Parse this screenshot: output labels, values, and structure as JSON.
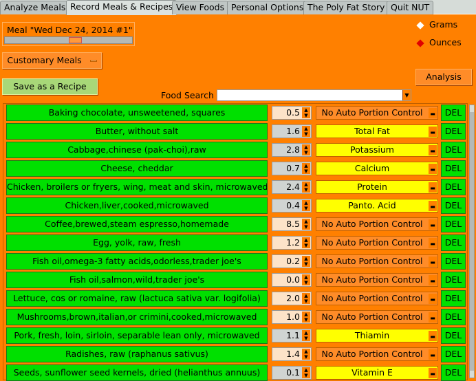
{
  "tabs": [
    "Analyze Meals",
    "Record Meals & Recipes",
    "View Foods",
    "Personal Options",
    "The Poly Fat Story",
    "Quit NUT"
  ],
  "active_tab": 1,
  "meal": {
    "label": "Meal \"Wed Dec 24, 2014 #1\""
  },
  "customary_meals": "Customary Meals",
  "save_recipe": "Save as a Recipe",
  "units": {
    "grams": "Grams",
    "ounces": "Ounces",
    "selected": "Ounces"
  },
  "analysis": "Analysis",
  "food_search": {
    "label": "Food Search",
    "value": ""
  },
  "del_label": "DEL",
  "colors": {
    "background": "#ff8000",
    "food": "#00e000",
    "auto": "#ffff00",
    "spin_manual": "#fde3c8",
    "spin_auto": "#d0d4d2"
  },
  "rows": [
    {
      "food": "Baking chocolate, unsweetened, squares",
      "qty": "0.5",
      "portion": "No Auto Portion Control",
      "auto": false
    },
    {
      "food": "Butter, without salt",
      "qty": "1.6",
      "portion": "Total Fat",
      "auto": true
    },
    {
      "food": "Cabbage,chinese (pak-choi),raw",
      "qty": "2.8",
      "portion": "Potassium",
      "auto": true
    },
    {
      "food": "Cheese, cheddar",
      "qty": "0.7",
      "portion": "Calcium",
      "auto": true
    },
    {
      "food": "Chicken, broilers or fryers, wing, meat and skin, microwaved",
      "qty": "2.4",
      "portion": "Protein",
      "auto": true
    },
    {
      "food": "Chicken,liver,cooked,microwaved",
      "qty": "0.4",
      "portion": "Panto. Acid",
      "auto": true
    },
    {
      "food": "Coffee,brewed,steam espresso,homemade",
      "qty": "8.5",
      "portion": "No Auto Portion Control",
      "auto": false
    },
    {
      "food": "Egg, yolk, raw, fresh",
      "qty": "1.2",
      "portion": "No Auto Portion Control",
      "auto": false
    },
    {
      "food": "Fish oil,omega-3 fatty acids,odorless,trader joe's",
      "qty": "0.2",
      "portion": "No Auto Portion Control",
      "auto": false
    },
    {
      "food": "Fish oil,salmon,wild,trader joe's",
      "qty": "0.0",
      "portion": "No Auto Portion Control",
      "auto": false
    },
    {
      "food": "Lettuce, cos or romaine, raw (lactuca sativa var. logifolia)",
      "qty": "2.0",
      "portion": "No Auto Portion Control",
      "auto": false
    },
    {
      "food": "Mushrooms,brown,italian,or crimini,cooked,microwaved",
      "qty": "1.0",
      "portion": "No Auto Portion Control",
      "auto": false
    },
    {
      "food": "Pork, fresh, loin, sirloin, separable lean only, microwaved",
      "qty": "1.1",
      "portion": "Thiamin",
      "auto": true
    },
    {
      "food": "Radishes, raw (raphanus sativus)",
      "qty": "1.4",
      "portion": "No Auto Portion Control",
      "auto": false
    },
    {
      "food": "Seeds, sunflower seed kernels, dried (helianthus annuus)",
      "qty": "0.1",
      "portion": "Vitamin E",
      "auto": true
    }
  ]
}
